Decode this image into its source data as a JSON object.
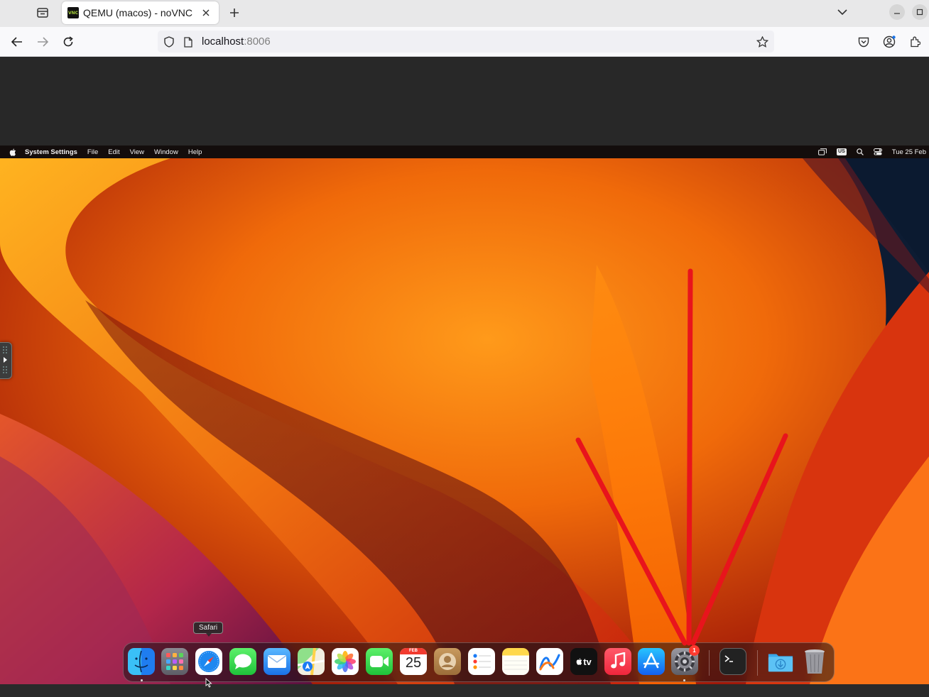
{
  "browser": {
    "tab_title": "QEMU (macos) - noVNC",
    "favicon_text": "VNC",
    "url_host": "localhost",
    "url_port": ":8006"
  },
  "mac": {
    "menubar": {
      "app_name": "System Settings",
      "menus": [
        "File",
        "Edit",
        "View",
        "Window",
        "Help"
      ],
      "keyboard_layout": "US",
      "clock": "Tue 25 Feb"
    },
    "tooltip": "Safari",
    "dock": {
      "apps": [
        {
          "name": "Finder",
          "icon": "finder-icon",
          "running": true
        },
        {
          "name": "Launchpad",
          "icon": "launchpad-icon"
        },
        {
          "name": "Safari",
          "icon": "safari-icon"
        },
        {
          "name": "Messages",
          "icon": "messages-icon"
        },
        {
          "name": "Mail",
          "icon": "mail-icon"
        },
        {
          "name": "Maps",
          "icon": "maps-icon"
        },
        {
          "name": "Photos",
          "icon": "photos-icon"
        },
        {
          "name": "FaceTime",
          "icon": "facetime-icon"
        },
        {
          "name": "Calendar",
          "icon": "calendar-icon",
          "month": "FEB",
          "day": "25"
        },
        {
          "name": "Contacts",
          "icon": "contacts-icon"
        },
        {
          "name": "Reminders",
          "icon": "reminders-icon"
        },
        {
          "name": "Notes",
          "icon": "notes-icon"
        },
        {
          "name": "Freeform",
          "icon": "freeform-icon"
        },
        {
          "name": "TV",
          "icon": "appletv-icon",
          "label": "tv"
        },
        {
          "name": "Music",
          "icon": "music-icon"
        },
        {
          "name": "App Store",
          "icon": "appstore-icon"
        },
        {
          "name": "System Settings",
          "icon": "system-settings-icon",
          "running": true,
          "badge": "1"
        },
        {
          "name": "Terminal",
          "icon": "terminal-icon"
        },
        {
          "name": "Downloads",
          "icon": "downloads-folder-icon"
        },
        {
          "name": "Trash",
          "icon": "trash-icon"
        }
      ]
    }
  },
  "colors": {
    "annotation": "#e8141c",
    "wallpaper_orange": "#ff8a00",
    "wallpaper_red": "#c81d0e"
  }
}
